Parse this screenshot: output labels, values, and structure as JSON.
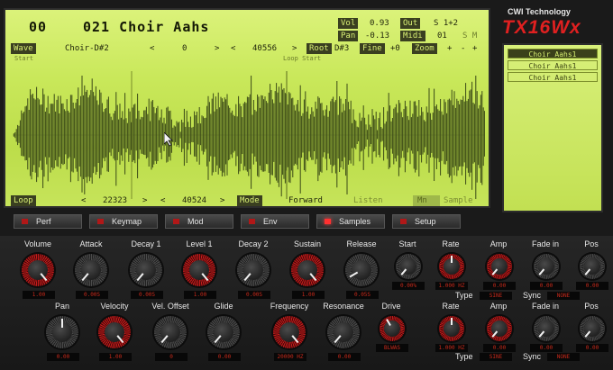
{
  "header": {
    "preset_num": "00",
    "preset_name": "021 Choir Aahs",
    "vol_label": "Vol",
    "vol_value": "0.93",
    "out_label": "Out",
    "out_value": "S 1+2",
    "pan_label": "Pan",
    "pan_value": "-0.13",
    "midi_label": "Midi",
    "midi_value": "01",
    "sm_value": "S M"
  },
  "wave_row": {
    "wave_label": "Wave",
    "wave_name": "Choir-D#2",
    "start_value": "0",
    "end_value": "40556",
    "root_label": "Root",
    "root_value": "D#3",
    "fine_label": "Fine",
    "fine_value": "+0",
    "zoom_label": "Zoom",
    "zoom_plus": "+",
    "zoom_minus": "-",
    "start_marker": "Start",
    "loop_start_marker": "Loop Start"
  },
  "loop_row": {
    "loop_label": "Loop",
    "loop_start": "22323",
    "loop_end": "40524",
    "mode_label": "Mode",
    "mode_value": "Forward",
    "listen": "Listen",
    "mn": "Mn",
    "sample": "Sample",
    "prev": "<",
    "next": ">"
  },
  "brand": {
    "line1": "CWI Technology",
    "line2": "TX16Wx"
  },
  "sample_list": [
    "Choir Aahs1",
    "Choir Aahs1",
    "Choir Aahs1"
  ],
  "tabs": [
    "Perf",
    "Keymap",
    "Mod",
    "Env",
    "Samples",
    "Setup"
  ],
  "knobs_row1": [
    {
      "label": "Volume",
      "value": "1.00",
      "red": true
    },
    {
      "label": "Attack",
      "value": "0.00S",
      "red": false
    },
    {
      "label": "Decay 1",
      "value": "0.00S",
      "red": false
    },
    {
      "label": "Level 1",
      "value": "1.00",
      "red": true
    },
    {
      "label": "Decay 2",
      "value": "0.00S",
      "red": false
    },
    {
      "label": "Sustain",
      "value": "1.00",
      "red": true
    },
    {
      "label": "Release",
      "value": "0.05S",
      "red": false
    },
    {
      "label": "Start",
      "value": "0.00%",
      "red": false
    },
    {
      "label": "Rate",
      "value": "1.000 HZ",
      "red": true
    },
    {
      "label": "Amp",
      "value": "0.00",
      "red": true
    },
    {
      "label": "Fade in",
      "value": "0.00",
      "red": false
    },
    {
      "label": "Pos",
      "value": "0.00",
      "red": false
    }
  ],
  "knobs_row2": [
    {
      "label": "Pan",
      "value": "0.00",
      "red": false
    },
    {
      "label": "Velocity",
      "value": "1.00",
      "red": true
    },
    {
      "label": "Vel. Offset",
      "value": "0",
      "red": false
    },
    {
      "label": "Glide",
      "value": "0.00",
      "red": false
    },
    {
      "label": "Frequency",
      "value": "20000 HZ",
      "red": true
    },
    {
      "label": "Resonance",
      "value": "0.00",
      "red": false
    },
    {
      "label": "Drive",
      "value": "BLWAS",
      "red": true
    },
    {
      "label": "Rate",
      "value": "1.000 HZ",
      "red": true
    },
    {
      "label": "Amp",
      "value": "0.00",
      "red": true
    },
    {
      "label": "Fade in",
      "value": "0.00",
      "red": false
    },
    {
      "label": "Pos",
      "value": "0.00",
      "red": false
    }
  ],
  "lfo1": {
    "type_label": "Type",
    "type_value": "SINE",
    "sync_label": "Sync",
    "sync_value": "NONE"
  },
  "lfo2": {
    "type_label": "Type",
    "type_value": "SINE",
    "sync_label": "Sync",
    "sync_value": "NONE"
  }
}
